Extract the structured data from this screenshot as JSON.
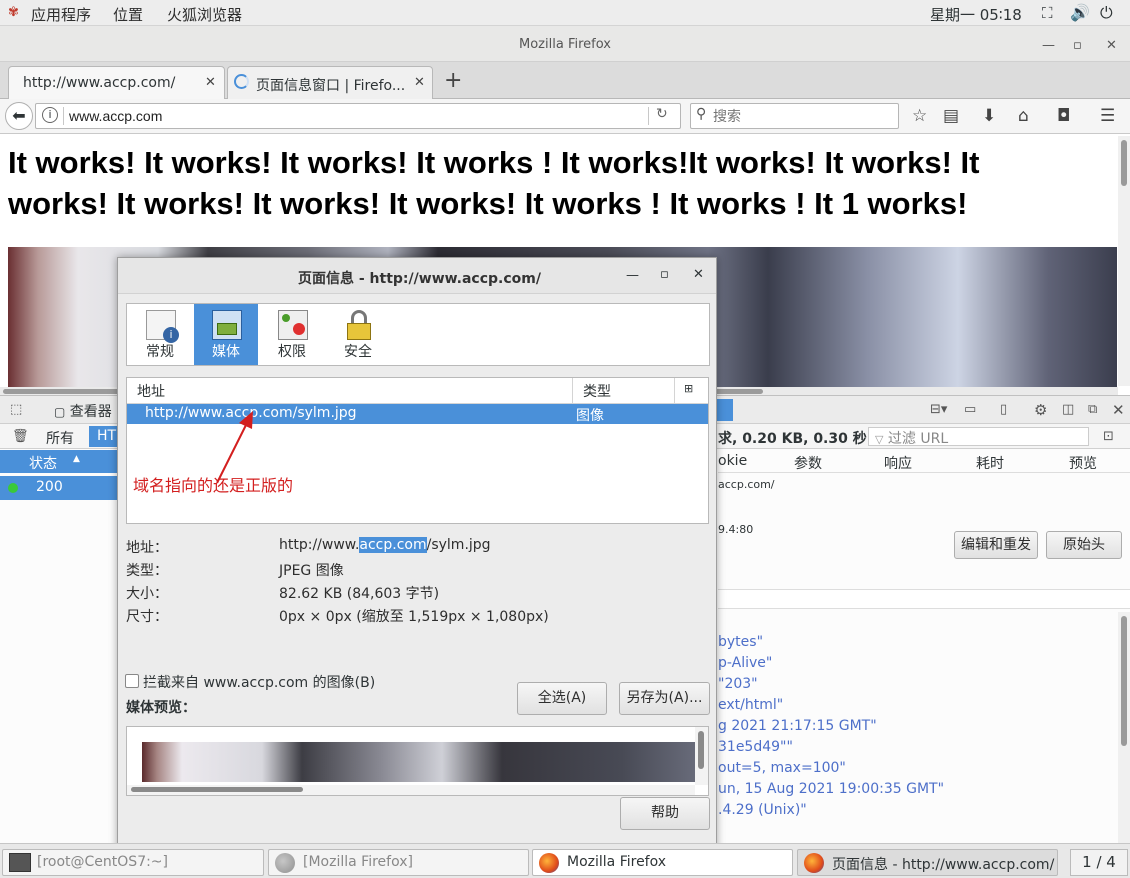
{
  "topbar": {
    "applications": "应用程序",
    "places": "位置",
    "firefox_menu": "火狐浏览器",
    "clock": "星期一 05∶18"
  },
  "window": {
    "title": "Mozilla Firefox"
  },
  "tabs": [
    {
      "label": "http://www.accp.com/"
    },
    {
      "label": "页面信息窗口 | Firefo..."
    }
  ],
  "navbar": {
    "url": "www.accp.com",
    "search_placeholder": "搜索"
  },
  "page": {
    "heading": "It works! It works! It works! It works ! It works!It works! It works! It works! It works! It works! It works! It works ! It works ! It 1 works!"
  },
  "devtools": {
    "inspector_tab": "查看器",
    "filter_all": "所有",
    "filter_html": "HT",
    "status_header": "状态",
    "status_value": "200",
    "summary": "求, 0.20 KB, 0.30 秒",
    "filter_url_placeholder": "过滤 URL",
    "detail_tabs": [
      "okie",
      "参数",
      "响应",
      "耗时",
      "预览"
    ],
    "request_url": "accp.com/",
    "remote_address": "9.4:80",
    "edit_resend": "编辑和重发",
    "raw_headers": "原始头",
    "headers": [
      "bytes\"",
      "p-Alive\"",
      "\"203\"",
      "ext/html\"",
      "g 2021 21:17:15 GMT\"",
      "31e5d49\"\"",
      "out=5, max=100\"",
      "un, 15 Aug 2021 19:00:35 GMT\"",
      ".4.29 (Unix)\""
    ]
  },
  "dialog": {
    "title": "页面信息 - http://www.accp.com/",
    "tabs": [
      {
        "label": "常规"
      },
      {
        "label": "媒体"
      },
      {
        "label": "权限"
      },
      {
        "label": "安全"
      }
    ],
    "list_header_address": "地址",
    "list_header_type": "类型",
    "row_address": "http://www.accp.com/sylm.jpg",
    "row_type": "图像",
    "labels": {
      "address": "地址：",
      "type": "类型：",
      "size": "大小：",
      "dimensions": "尺寸："
    },
    "values": {
      "address_prefix": "http://www.",
      "address_selected": "accp.com",
      "address_suffix": "/sylm.jpg",
      "type": "JPEG 图像",
      "size": "82.62 KB (84,603 字节)",
      "dimensions": "0px × 0px (缩放至 1,519px × 1,080px)"
    },
    "block_images": "拦截来自 www.accp.com 的图像(B)",
    "select_all": "全选(A)",
    "save_as": "另存为(A)...",
    "media_preview": "媒体预览：",
    "help": "帮助"
  },
  "annotation": "域名指向的还是正版的",
  "taskbar": [
    {
      "label": "[root@CentOS7:~]"
    },
    {
      "label": "[Mozilla Firefox]"
    },
    {
      "label": "Mozilla Firefox"
    },
    {
      "label": "页面信息 - http://www.accp.com/"
    }
  ],
  "workspace": "1 / 4",
  "colors": {
    "selection": "#4a90d9",
    "annotation": "#d31f1f"
  }
}
